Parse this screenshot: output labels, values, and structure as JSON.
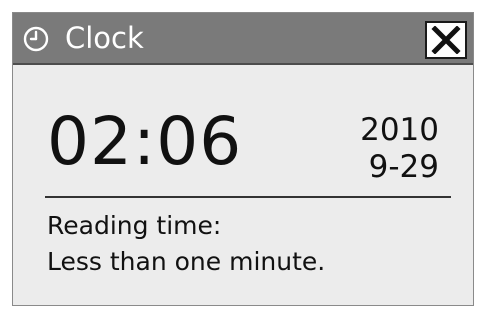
{
  "window": {
    "title": "Clock",
    "title_icon": "clock-icon",
    "close_icon": "close-icon"
  },
  "clock": {
    "time": "02:06",
    "year": "2010",
    "month_day": "9-29"
  },
  "reading": {
    "label": "Reading time:",
    "value": "Less than one minute."
  },
  "colors": {
    "title_bar": "#7a7a7a",
    "window_background": "#ececec",
    "text": "#111111",
    "title_text": "#ffffff"
  }
}
